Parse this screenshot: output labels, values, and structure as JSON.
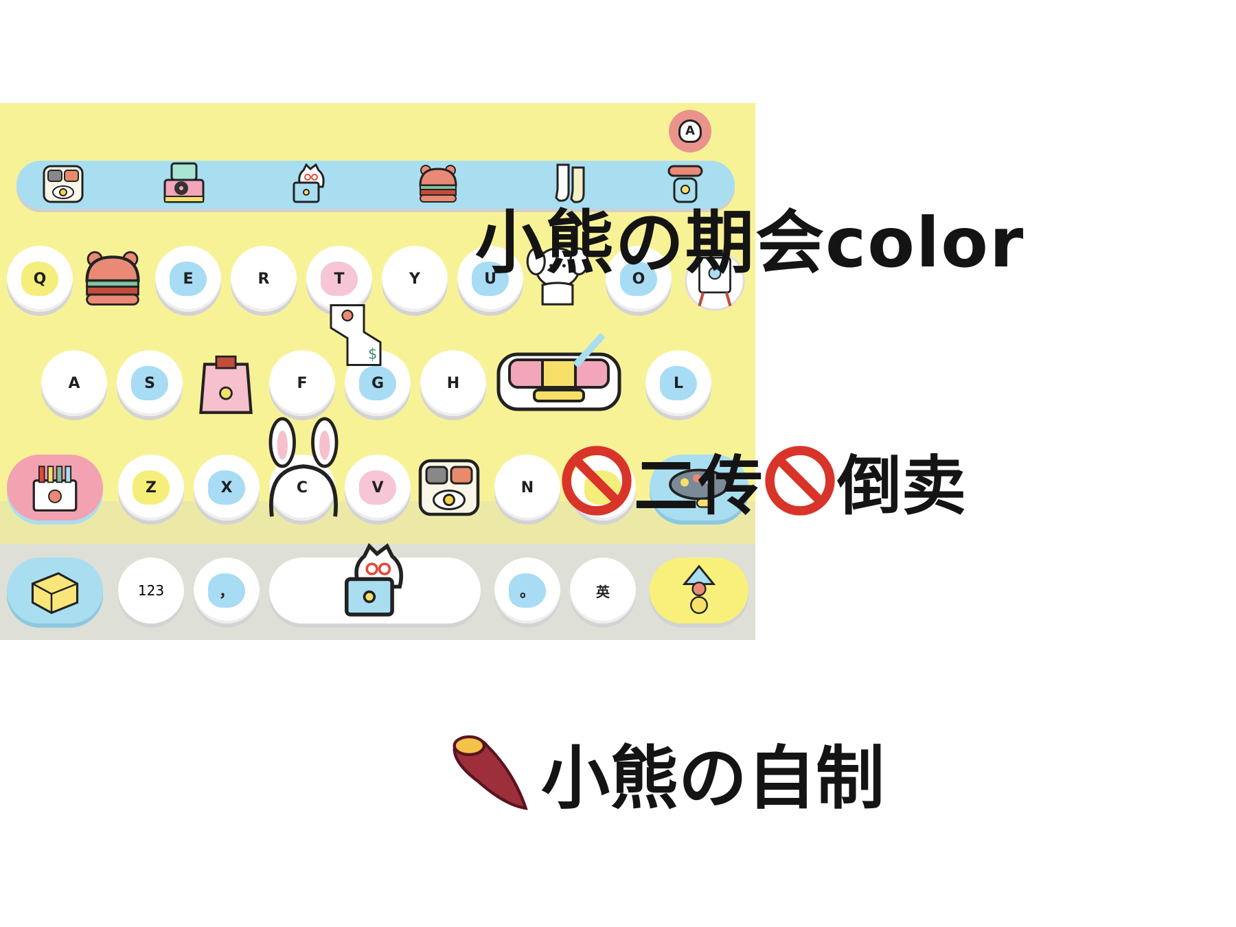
{
  "keyboard": {
    "accent_colors": {
      "yellow": "#f8f296",
      "blue": "#a9def0",
      "pink": "#f2a2b1",
      "bottom": "#dedfd6"
    },
    "toolbar_icons": [
      "bento-box-icon",
      "record-player-icon",
      "cat-laptop-icon",
      "bear-burger-icon",
      "socks-icon",
      "rolling-pin-icon"
    ],
    "row1": [
      "Q",
      "",
      "E",
      "R",
      "T",
      "Y",
      "U",
      "",
      "O",
      ""
    ],
    "row2": [
      "A",
      "S",
      "",
      "F",
      "G",
      "H",
      "",
      "",
      "L"
    ],
    "row3": [
      "Z",
      "X",
      "C",
      "V",
      "",
      "N"
    ],
    "bottom_row": {
      "numbers": "123",
      "comma": "，",
      "period": "。",
      "lang": "英"
    }
  },
  "overlay": {
    "title": "小熊の期会color",
    "notice_part1": "二传",
    "notice_part2": "倒卖",
    "credit": "小熊の自制"
  },
  "icons": {
    "prohibited": "prohibited-icon",
    "sweet_potato": "sweet-potato-icon"
  }
}
